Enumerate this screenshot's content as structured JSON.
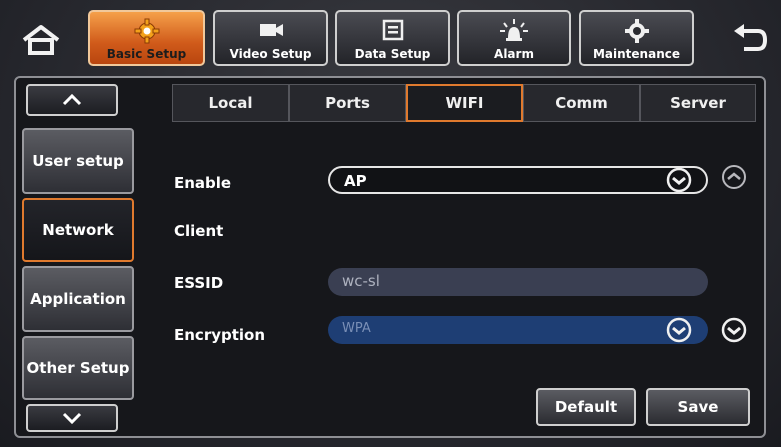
{
  "topnav": {
    "tabs": [
      {
        "label": "Basic Setup",
        "icon": "gear-icon",
        "active": true
      },
      {
        "label": "Video Setup",
        "icon": "video-camera-icon",
        "active": false
      },
      {
        "label": "Data Setup",
        "icon": "storage-icon",
        "active": false
      },
      {
        "label": "Alarm",
        "icon": "alarm-light-icon",
        "active": false
      },
      {
        "label": "Maintenance",
        "icon": "maintenance-gear-icon",
        "active": false
      }
    ],
    "home_icon": "home-icon",
    "back_icon": "back-arrow-icon"
  },
  "sidebar": {
    "items": [
      {
        "label": "User setup",
        "active": false
      },
      {
        "label": "Network",
        "active": true
      },
      {
        "label": "Application",
        "active": false
      },
      {
        "label": "Other Setup",
        "active": false
      }
    ]
  },
  "tabs": [
    {
      "label": "Local",
      "active": false
    },
    {
      "label": "Ports",
      "active": false
    },
    {
      "label": "WIFI",
      "active": true
    },
    {
      "label": "Comm",
      "active": false
    },
    {
      "label": "Server",
      "active": false
    }
  ],
  "form": {
    "enable_label": "Enable",
    "enable_value": "AP",
    "client_label": "Client",
    "essid_label": "ESSID",
    "essid_value": "wc-sl",
    "encryption_label": "Encryption",
    "encryption_value": "WPA"
  },
  "actions": {
    "default_label": "Default",
    "save_label": "Save"
  },
  "colors": {
    "accent": "#e07a2e",
    "active_tab_fill": "#d05a1a",
    "field_blue": "#1e3e74"
  }
}
